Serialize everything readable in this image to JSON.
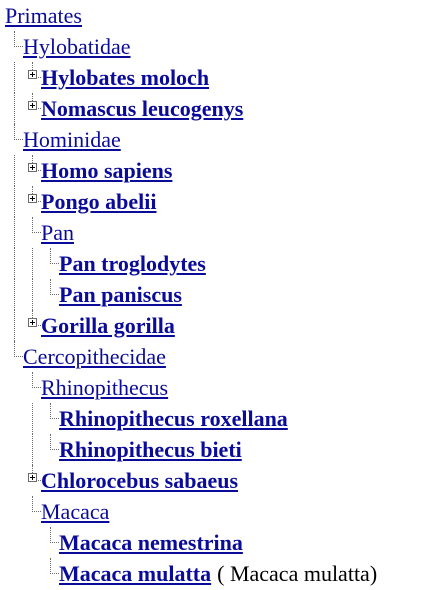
{
  "tree": {
    "rows": [
      {
        "name": "Primates",
        "depth": 0,
        "leaf": false,
        "expander": false
      },
      {
        "name": "Hylobatidae",
        "depth": 1,
        "leaf": false,
        "expander": false
      },
      {
        "name": "Hylobates moloch",
        "depth": 2,
        "leaf": true,
        "expander": true
      },
      {
        "name": "Nomascus leucogenys",
        "depth": 2,
        "leaf": true,
        "expander": true
      },
      {
        "name": "Hominidae",
        "depth": 1,
        "leaf": false,
        "expander": false
      },
      {
        "name": "Homo sapiens",
        "depth": 2,
        "leaf": true,
        "expander": true
      },
      {
        "name": "Pongo abelii",
        "depth": 2,
        "leaf": true,
        "expander": true
      },
      {
        "name": "Pan",
        "depth": 2,
        "leaf": false,
        "expander": false
      },
      {
        "name": "Pan troglodytes",
        "depth": 3,
        "leaf": true,
        "expander": false
      },
      {
        "name": "Pan paniscus",
        "depth": 3,
        "leaf": true,
        "expander": false
      },
      {
        "name": "Gorilla gorilla",
        "depth": 2,
        "leaf": true,
        "expander": true
      },
      {
        "name": "Cercopithecidae",
        "depth": 1,
        "leaf": false,
        "expander": false
      },
      {
        "name": "Rhinopithecus",
        "depth": 2,
        "leaf": false,
        "expander": false
      },
      {
        "name": "Rhinopithecus roxellana",
        "depth": 3,
        "leaf": true,
        "expander": false
      },
      {
        "name": "Rhinopithecus bieti",
        "depth": 3,
        "leaf": true,
        "expander": false
      },
      {
        "name": "Chlorocebus sabaeus",
        "depth": 2,
        "leaf": true,
        "expander": true
      },
      {
        "name": "Macaca",
        "depth": 2,
        "leaf": false,
        "expander": false
      },
      {
        "name": "Macaca nemestrina",
        "depth": 3,
        "leaf": true,
        "expander": false
      },
      {
        "name": "Macaca mulatta",
        "depth": 3,
        "leaf": true,
        "expander": false,
        "note": "( Macaca mulatta)"
      }
    ]
  },
  "colors": {
    "link": "#0b0b9a",
    "guide": "#6b6b6b"
  },
  "icons": {
    "expander": "plus-box-icon"
  }
}
